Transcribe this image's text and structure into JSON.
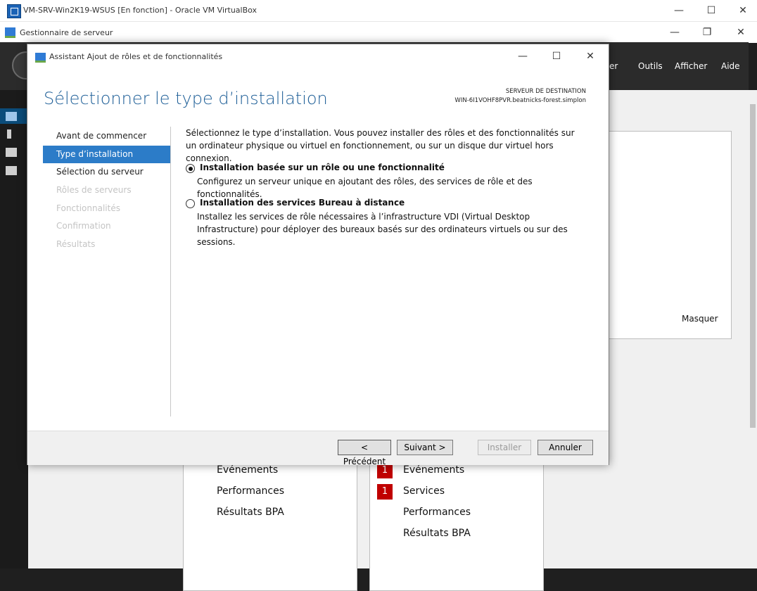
{
  "vbox": {
    "title": "VM-SRV-Win2K19-WSUS [En fonction] - Oracle VM VirtualBox",
    "controls": {
      "minimize": "—",
      "maximize": "☐",
      "close": "✕"
    }
  },
  "server_manager": {
    "title": "Gestionnaire de serveur",
    "controls": {
      "minimize": "—",
      "restore": "❐",
      "close": "✕"
    },
    "menu": {
      "partial": "er",
      "tools": "Outils",
      "view": "Afficher",
      "help": "Aide"
    },
    "hide_label": "Masquer",
    "tile_left": {
      "items": [
        "Événements",
        "Performances",
        "Résultats BPA"
      ]
    },
    "tile_right": {
      "items": [
        {
          "badge": "1",
          "label": "Événements"
        },
        {
          "badge": "1",
          "label": "Services"
        },
        {
          "badge": "",
          "label": "Performances"
        },
        {
          "badge": "",
          "label": "Résultats BPA"
        }
      ]
    }
  },
  "wizard": {
    "title": "Assistant Ajout de rôles et de fonctionnalités",
    "controls": {
      "minimize": "—",
      "maximize": "☐",
      "close": "✕"
    },
    "heading": "Sélectionner le type d’installation",
    "destination_label": "SERVEUR DE DESTINATION",
    "destination_server": "WIN-6I1VOHF8PVR.beatnicks-forest.simplon",
    "nav": [
      {
        "label": "Avant de commencer",
        "state": "normal"
      },
      {
        "label": "Type d’installation",
        "state": "active"
      },
      {
        "label": "Sélection du serveur",
        "state": "normal"
      },
      {
        "label": "Rôles de serveurs",
        "state": "disabled"
      },
      {
        "label": "Fonctionnalités",
        "state": "disabled"
      },
      {
        "label": "Confirmation",
        "state": "disabled"
      },
      {
        "label": "Résultats",
        "state": "disabled"
      }
    ],
    "intro": "Sélectionnez le type d’installation. Vous pouvez installer des rôles et des fonctionnalités sur un ordinateur physique ou virtuel en fonctionnement, ou sur un disque dur virtuel hors connexion.",
    "options": [
      {
        "title": "Installation basée sur un rôle ou une fonctionnalité",
        "description": "Configurez un serveur unique en ajoutant des rôles, des services de rôle et des fonctionnalités.",
        "selected": true
      },
      {
        "title": "Installation des services Bureau à distance",
        "description": "Installez les services de rôle nécessaires à l’infrastructure VDI (Virtual Desktop Infrastructure) pour déployer des bureaux basés sur des ordinateurs virtuels ou sur des sessions.",
        "selected": false
      }
    ],
    "buttons": {
      "previous": "< Précédent",
      "next": "Suivant >",
      "install": "Installer",
      "cancel": "Annuler"
    }
  }
}
